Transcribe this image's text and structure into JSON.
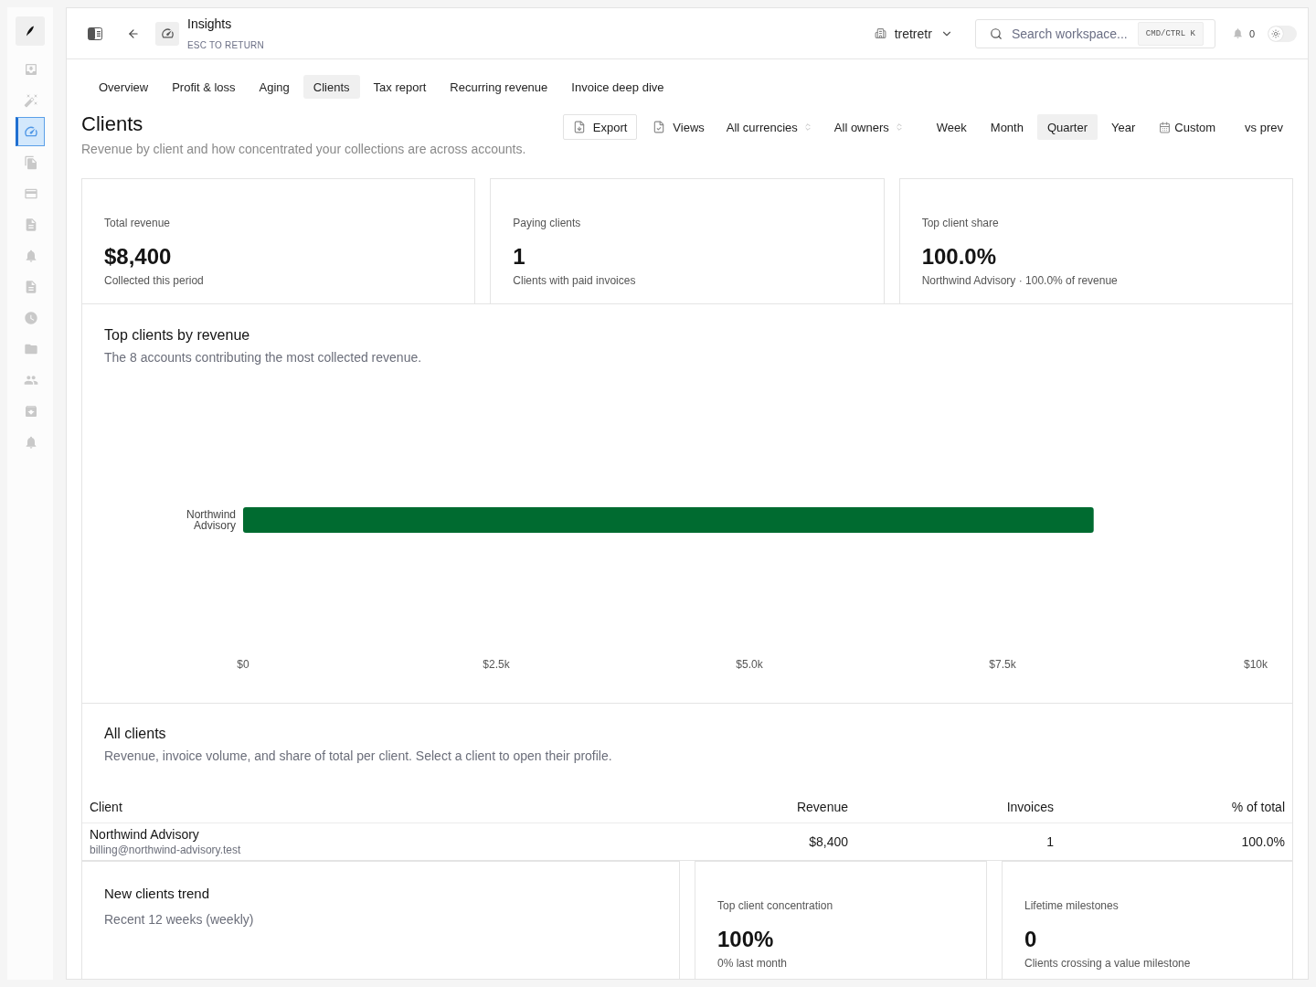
{
  "rail": {
    "items": [
      {
        "selected": false
      },
      {
        "selected": false
      },
      {
        "selected": true
      },
      {
        "selected": false
      },
      {
        "selected": false
      },
      {
        "selected": false
      },
      {
        "selected": false
      },
      {
        "selected": false
      },
      {
        "selected": false
      },
      {
        "selected": false
      },
      {
        "selected": false
      },
      {
        "selected": false
      },
      {
        "selected": false
      }
    ]
  },
  "header": {
    "title": "Insights",
    "hint": "ESC TO RETURN",
    "workspace": "tretretr",
    "search": {
      "placeholder": "Search workspace...",
      "shortcut": "CMD/CTRL K"
    },
    "notifications": "0",
    "theme_toggle": {
      "on": false
    }
  },
  "tabs": [
    {
      "label": "Overview",
      "selected": false
    },
    {
      "label": "Profit & loss",
      "selected": false
    },
    {
      "label": "Aging",
      "selected": false
    },
    {
      "label": "Clients",
      "selected": true
    },
    {
      "label": "Tax report",
      "selected": false
    },
    {
      "label": "Recurring revenue",
      "selected": false
    },
    {
      "label": "Invoice deep dive",
      "selected": false
    }
  ],
  "page": {
    "title": "Clients",
    "subtitle": "Revenue by client and how concentrated your collections are across accounts."
  },
  "toolbar": {
    "actions": [
      {
        "kind": "export",
        "label": "Export"
      },
      {
        "kind": "views",
        "label": "Views"
      }
    ],
    "filters": [
      {
        "label": "All currencies"
      },
      {
        "label": "All owners"
      }
    ],
    "periods": [
      {
        "kind": "preset",
        "label": "Week",
        "selected": false
      },
      {
        "kind": "preset",
        "label": "Month",
        "selected": false
      },
      {
        "kind": "preset",
        "label": "Quarter",
        "selected": true
      },
      {
        "kind": "preset",
        "label": "Year",
        "selected": false
      },
      {
        "kind": "custom",
        "label": "Custom",
        "selected": false
      }
    ],
    "compare": {
      "label": "vs prev"
    }
  },
  "stats": [
    {
      "label": "Total revenue",
      "value": "$8,400",
      "note": "Collected this period"
    },
    {
      "label": "Paying clients",
      "value": "1",
      "note": "Clients with paid invoices"
    },
    {
      "label": "Top client share",
      "value": "100.0%",
      "note": "Northwind Advisory · 100.0% of revenue"
    }
  ],
  "top_clients": {
    "title": "Top clients by revenue",
    "subtitle": "The 8 accounts contributing the most collected revenue.",
    "chart_data": {
      "type": "bar",
      "orientation": "horizontal",
      "categories": [
        "Northwind Advisory"
      ],
      "values": [
        8400
      ],
      "xlim": [
        0,
        10000
      ],
      "xticks": [
        {
          "value": 0,
          "label": "$0"
        },
        {
          "value": 2500,
          "label": "$2.5k"
        },
        {
          "value": 5000,
          "label": "$5.0k"
        },
        {
          "value": 7500,
          "label": "$7.5k"
        },
        {
          "value": 10000,
          "label": "$10k"
        }
      ]
    }
  },
  "all_clients": {
    "title": "All clients",
    "subtitle": "Revenue, invoice volume, and share of total per client. Select a client to open their profile.",
    "table": {
      "columns": [
        "Client",
        "Revenue",
        "Invoices",
        "% of total"
      ],
      "rows": [
        {
          "client": "Northwind Advisory",
          "email": "billing@northwind-advisory.test",
          "revenue": "$8,400",
          "invoices": "1",
          "share": "100.0%"
        }
      ]
    }
  },
  "bottom": {
    "trend": {
      "title": "New clients trend",
      "subtitle": "Recent 12 weeks (weekly)"
    },
    "stats": [
      {
        "label": "Top client concentration",
        "value": "100%",
        "note": "0% last month"
      },
      {
        "label": "Lifetime milestones",
        "value": "0",
        "note": "Clients crossing a value milestone"
      }
    ]
  }
}
